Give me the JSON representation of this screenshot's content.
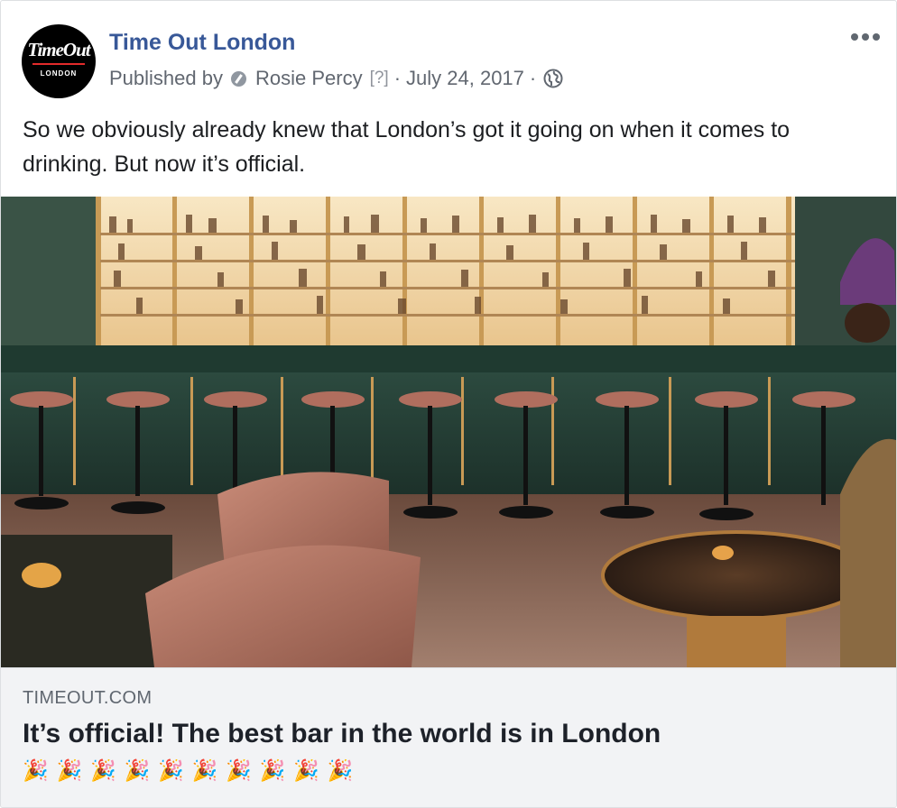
{
  "post": {
    "page_name": "Time Out London",
    "avatar": {
      "logo_text": "TimeOut",
      "logo_sub": "LONDON"
    },
    "meta": {
      "published_by": "Published by",
      "author": "Rosie Percy",
      "help": "[?]",
      "sep1": "·",
      "date": "July 24, 2017",
      "sep2": "·"
    },
    "message": "So we obviously already knew that London’s got it going on when it comes to drinking. But now it’s official.",
    "icons": {
      "more": "more-options-icon",
      "privacy": "globe-icon",
      "verified": "verified-publisher-icon"
    }
  },
  "link_preview": {
    "domain": "TIMEOUT.COM",
    "title": "It’s official! The best bar in the world is in London",
    "emojis": [
      "🎉",
      "🎉",
      "🎉",
      "🎉",
      "🎉",
      "🎉",
      "🎉",
      "🎉",
      "🎉",
      "🎉"
    ]
  },
  "colors": {
    "link_blue": "#385898",
    "meta_gray": "#616770",
    "preview_bg": "#f2f3f5"
  }
}
